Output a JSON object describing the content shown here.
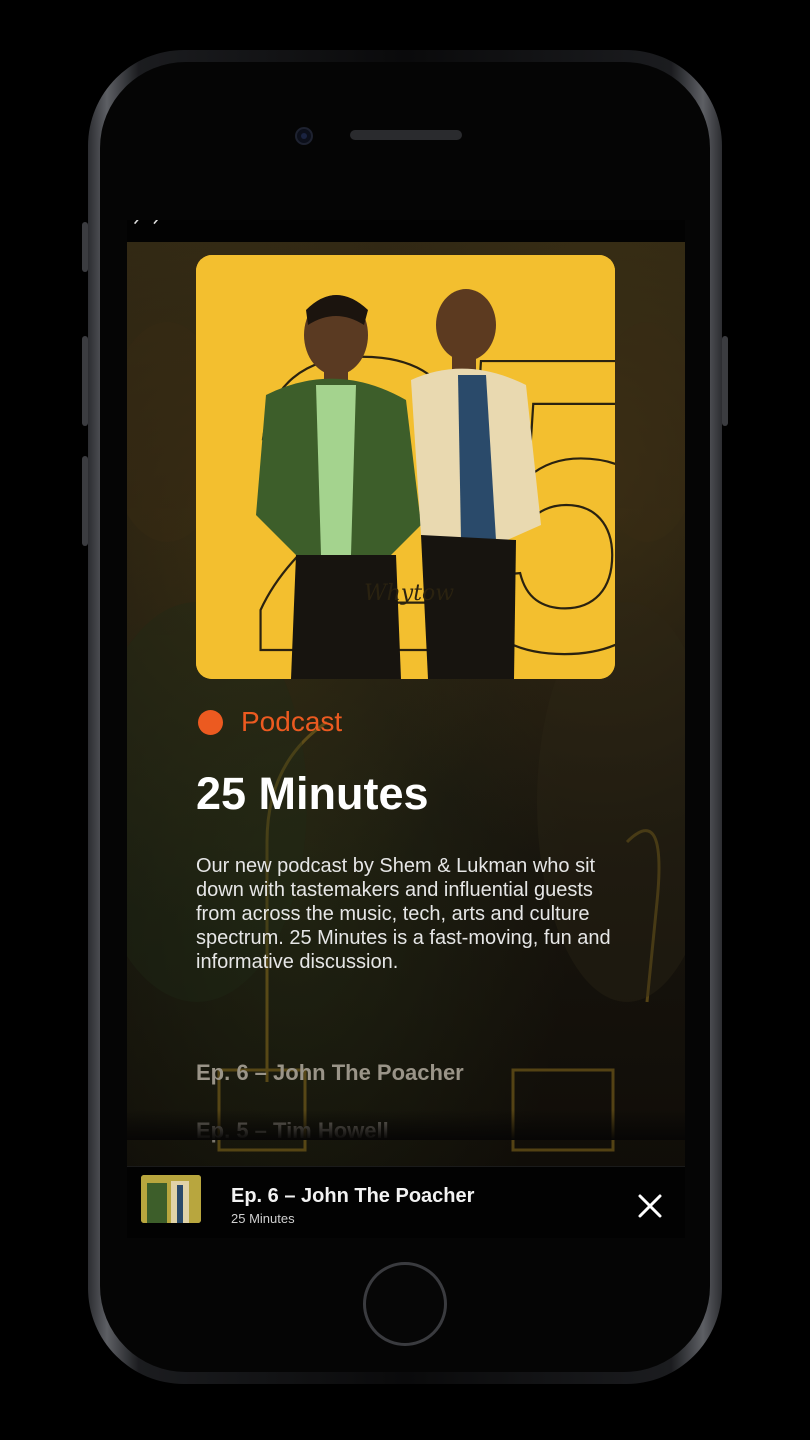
{
  "status_bar": {
    "glyph": "ᐟ ᐟ"
  },
  "podcast": {
    "category": "Podcast",
    "title": "25 Minutes",
    "description": "Our new podcast by Shem & Lukman who sit down with tastemakers and influential guests from across the music, tech, arts and culture spectrum. 25 Minutes is a fast-moving, fun and informative discussion.",
    "cover_signature": "Whytow",
    "cover_numerals": "25"
  },
  "episodes": [
    {
      "label": "Ep. 6 – John The Poacher"
    },
    {
      "label": "Ep. 5 – Tim Howell"
    }
  ],
  "player": {
    "title": "Ep. 6 – John The Poacher",
    "subtitle": "25 Minutes",
    "close_icon": "close-icon"
  },
  "colors": {
    "accent": "#ec5a20",
    "cover_yellow": "#f3bf2f",
    "background": "#000000"
  }
}
